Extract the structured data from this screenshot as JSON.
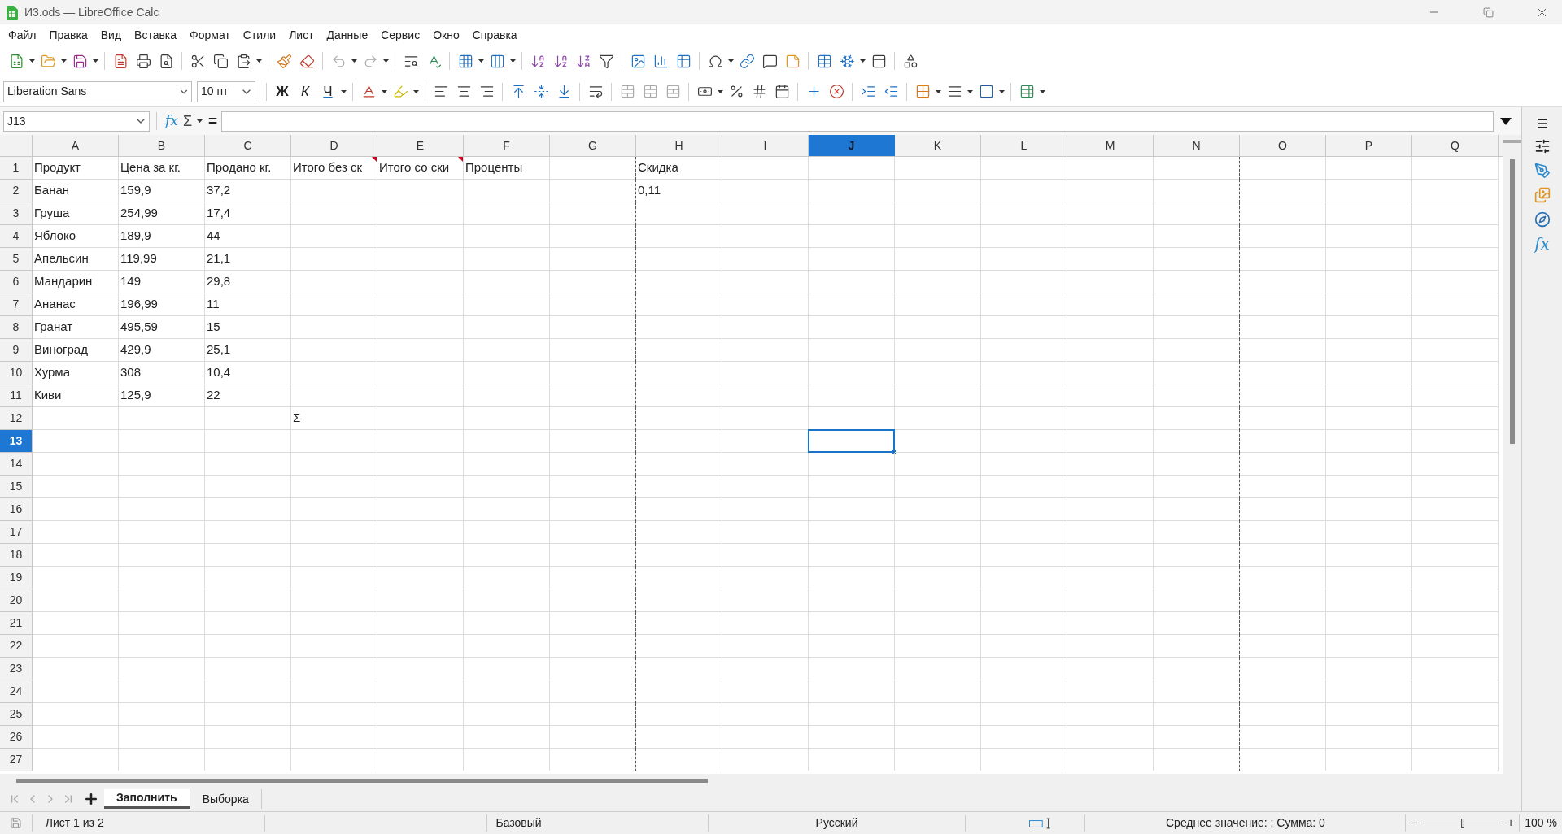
{
  "window": {
    "title": "И3.ods — LibreOffice Calc"
  },
  "menu": [
    "Файл",
    "Правка",
    "Вид",
    "Вставка",
    "Формат",
    "Стили",
    "Лист",
    "Данные",
    "Сервис",
    "Окно",
    "Справка"
  ],
  "formatting": {
    "font_name": "Liberation Sans",
    "font_size": "10 пт",
    "bold": "Ж",
    "italic": "К",
    "underline": "Ч"
  },
  "formula_bar": {
    "name_box": "J13",
    "function_wizard": "fx",
    "sum": "Σ",
    "equals": "="
  },
  "sheet": {
    "columns": [
      {
        "label": "A",
        "selected": false,
        "page_break_after": false
      },
      {
        "label": "B",
        "selected": false,
        "page_break_after": false
      },
      {
        "label": "C",
        "selected": false,
        "page_break_after": false
      },
      {
        "label": "D",
        "selected": false,
        "page_break_after": false
      },
      {
        "label": "E",
        "selected": false,
        "page_break_after": false
      },
      {
        "label": "F",
        "selected": false,
        "page_break_after": false
      },
      {
        "label": "G",
        "selected": false,
        "page_break_after": true
      },
      {
        "label": "H",
        "selected": false,
        "page_break_after": false
      },
      {
        "label": "I",
        "selected": false,
        "page_break_after": false
      },
      {
        "label": "J",
        "selected": true,
        "page_break_after": false
      },
      {
        "label": "K",
        "selected": false,
        "page_break_after": false
      },
      {
        "label": "L",
        "selected": false,
        "page_break_after": false
      },
      {
        "label": "M",
        "selected": false,
        "page_break_after": false
      },
      {
        "label": "N",
        "selected": false,
        "page_break_after": true
      },
      {
        "label": "O",
        "selected": false,
        "page_break_after": false
      },
      {
        "label": "P",
        "selected": false,
        "page_break_after": false
      },
      {
        "label": "Q",
        "selected": false,
        "page_break_after": false
      }
    ],
    "rows": [
      {
        "label": "1",
        "selected": false,
        "cells": [
          {
            "text": "Продукт",
            "comment": false
          },
          {
            "text": "Цена за кг.",
            "comment": false
          },
          {
            "text": "Продано кг.",
            "comment": false
          },
          {
            "text": "Итого без ск",
            "comment": true
          },
          {
            "text": "Итого со ски",
            "comment": true
          },
          {
            "text": "Проценты",
            "comment": false
          },
          null,
          {
            "text": "Скидка",
            "comment": false
          }
        ]
      },
      {
        "label": "2",
        "selected": false,
        "cells": [
          {
            "text": "Банан",
            "comment": false
          },
          {
            "text": "159,9",
            "comment": false
          },
          {
            "text": "37,2",
            "comment": false
          },
          null,
          null,
          null,
          null,
          {
            "text": "0,11",
            "comment": false
          }
        ]
      },
      {
        "label": "3",
        "selected": false,
        "cells": [
          {
            "text": "Груша",
            "comment": false
          },
          {
            "text": "254,99",
            "comment": false
          },
          {
            "text": "17,4",
            "comment": false
          }
        ]
      },
      {
        "label": "4",
        "selected": false,
        "cells": [
          {
            "text": "Яблоко",
            "comment": false
          },
          {
            "text": "189,9",
            "comment": false
          },
          {
            "text": "44",
            "comment": false
          }
        ]
      },
      {
        "label": "5",
        "selected": false,
        "cells": [
          {
            "text": "Апельсин",
            "comment": false
          },
          {
            "text": "119,99",
            "comment": false
          },
          {
            "text": "21,1",
            "comment": false
          }
        ]
      },
      {
        "label": "6",
        "selected": false,
        "cells": [
          {
            "text": "Мандарин",
            "comment": false
          },
          {
            "text": "149",
            "comment": false
          },
          {
            "text": "29,8",
            "comment": false
          }
        ]
      },
      {
        "label": "7",
        "selected": false,
        "cells": [
          {
            "text": "Ананас",
            "comment": false
          },
          {
            "text": "196,99",
            "comment": false
          },
          {
            "text": "11",
            "comment": false
          }
        ]
      },
      {
        "label": "8",
        "selected": false,
        "cells": [
          {
            "text": "Гранат",
            "comment": false
          },
          {
            "text": "495,59",
            "comment": false
          },
          {
            "text": "15",
            "comment": false
          }
        ]
      },
      {
        "label": "9",
        "selected": false,
        "cells": [
          {
            "text": "Виноград",
            "comment": false
          },
          {
            "text": "429,9",
            "comment": false
          },
          {
            "text": "25,1",
            "comment": false
          }
        ]
      },
      {
        "label": "10",
        "selected": false,
        "cells": [
          {
            "text": "Хурма",
            "comment": false
          },
          {
            "text": "308",
            "comment": false
          },
          {
            "text": "10,4",
            "comment": false
          }
        ]
      },
      {
        "label": "11",
        "selected": false,
        "cells": [
          {
            "text": "Киви",
            "comment": false
          },
          {
            "text": "125,9",
            "comment": false
          },
          {
            "text": "22",
            "comment": false
          }
        ]
      },
      {
        "label": "12",
        "selected": false,
        "cells": [
          null,
          null,
          null,
          {
            "text": "Σ",
            "comment": false
          }
        ]
      },
      {
        "label": "13",
        "selected": true
      },
      {
        "label": "14",
        "selected": false
      },
      {
        "label": "15",
        "selected": false
      },
      {
        "label": "16",
        "selected": false
      },
      {
        "label": "17",
        "selected": false
      },
      {
        "label": "18",
        "selected": false
      },
      {
        "label": "19",
        "selected": false
      },
      {
        "label": "20",
        "selected": false
      },
      {
        "label": "21",
        "selected": false
      },
      {
        "label": "22",
        "selected": false
      },
      {
        "label": "23",
        "selected": false
      },
      {
        "label": "24",
        "selected": false
      },
      {
        "label": "25",
        "selected": false
      },
      {
        "label": "26",
        "selected": false
      },
      {
        "label": "27",
        "selected": false
      }
    ]
  },
  "sheet_tabs": [
    {
      "label": "Заполнить",
      "selected": true
    },
    {
      "label": "Выборка",
      "selected": false
    }
  ],
  "sidebar": {
    "functions": "fx"
  },
  "status_bar": {
    "sheet": "Лист 1 из 2",
    "page_style": "Базовый",
    "language": "Русский",
    "summary": "Среднее значение: ; Сумма: 0",
    "zoom_out": "−",
    "zoom_in": "+",
    "zoom": {
      "level": 0.5
    },
    "zoom_value": "100 %"
  }
}
